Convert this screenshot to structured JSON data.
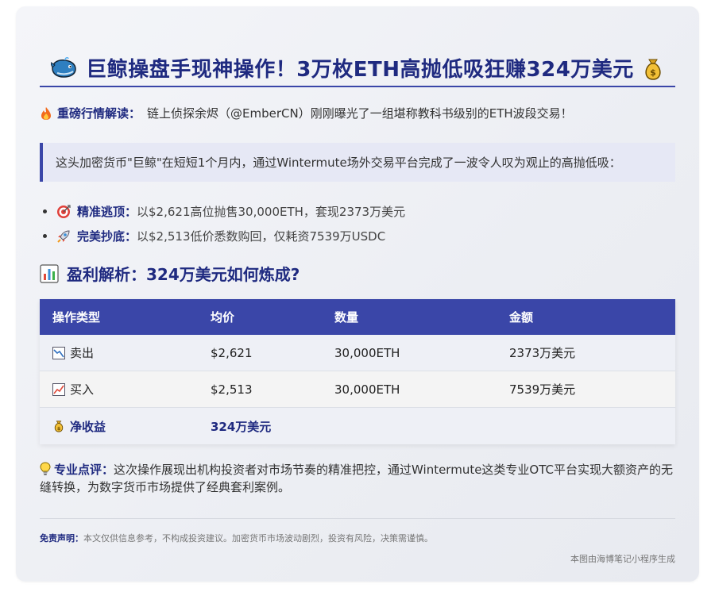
{
  "header": {
    "title": "巨鲸操盘手现神操作！3万枚ETH高抛低吸狂赚324万美元",
    "left_icon": "whale-icon",
    "right_icon": "money-bag-icon"
  },
  "intro": {
    "icon": "fire-icon",
    "label": "重磅行情解读：",
    "text": "链上侦探余烬（@EmberCN）刚刚曝光了一组堪称教科书级别的ETH波段交易！"
  },
  "quote": {
    "text": "这头加密货币\"巨鲸\"在短短1个月内，通过Wintermute场外交易平台完成了一波令人叹为观止的高抛低吸："
  },
  "bullets": [
    {
      "icon": "target-icon",
      "label": "精准逃顶：",
      "text": "以$2,621高位抛售30,000ETH，套现2373万美元"
    },
    {
      "icon": "rocket-icon",
      "label": "完美抄底：",
      "text": "以$2,513低价悉数购回，仅耗资7539万USDC"
    }
  ],
  "section": {
    "icon": "bar-chart-icon",
    "title": "盈利解析：324万美元如何炼成?"
  },
  "table": {
    "headers": [
      "操作类型",
      "均价",
      "数量",
      "金额"
    ],
    "rows": [
      {
        "icon": "chart-down-icon",
        "type": "卖出",
        "price": "$2,621",
        "qty": "30,000ETH",
        "amount": "2373万美元"
      },
      {
        "icon": "chart-up-icon",
        "type": "买入",
        "price": "$2,513",
        "qty": "30,000ETH",
        "amount": "7539万美元"
      }
    ],
    "net": {
      "icon": "money-bag-icon",
      "label": "净收益",
      "value": "324万美元"
    }
  },
  "comment": {
    "icon": "lightbulb-icon",
    "label": "专业点评：",
    "text": "这次操作展现出机构投资者对市场节奏的精准把控，通过Wintermute这类专业OTC平台实现大额资产的无缝转换，为数字货币市场提供了经典套利案例。"
  },
  "disclaimer": {
    "label": "免责声明：",
    "text": "本文仅供信息参考，不构成投资建议。加密货币市场波动剧烈，投资有风险，决策需谨慎。"
  },
  "credit": "本图由海博笔记小程序生成",
  "colors": {
    "accent": "#3a46a8",
    "title": "#1f2a80",
    "card_bg": "#eceef3"
  }
}
